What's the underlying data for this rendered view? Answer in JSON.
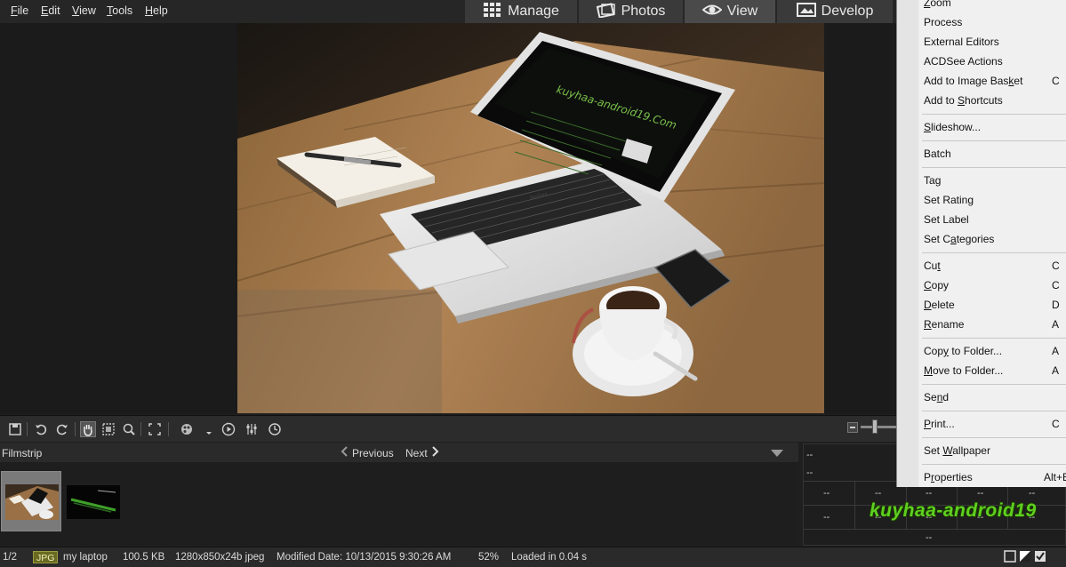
{
  "menubar": {
    "items": [
      "File",
      "Edit",
      "View",
      "Tools",
      "Help"
    ],
    "underline_letters": [
      "F",
      "E",
      "V",
      "T",
      "H"
    ]
  },
  "modes": [
    {
      "label": "Manage",
      "icon": "grid-icon"
    },
    {
      "label": "Photos",
      "icon": "photos-icon"
    },
    {
      "label": "View",
      "icon": "eye-icon",
      "active": true
    },
    {
      "label": "Develop",
      "icon": "develop-icon"
    }
  ],
  "photo": {
    "screen_brand": "kuyhaa-android19.Com",
    "keyboard_brand": "kuyhaa"
  },
  "toolbar": {
    "icons": [
      "save-icon",
      "rotate-left-icon",
      "rotate-right-icon",
      "hand-tool-icon",
      "select-tool-icon",
      "zoom-tool-icon",
      "fit-screen-icon",
      "color-wheel-icon",
      "dropdown-caret-icon",
      "play-slideshow-icon",
      "adjust-sliders-icon",
      "history-icon"
    ],
    "active_icon": "hand-tool-icon"
  },
  "filmstrip": {
    "title": "Filmstrip",
    "previous_label": "Previous",
    "next_label": "Next"
  },
  "info_panel": {
    "row1": "--",
    "row2": "--",
    "grid_values": [
      "--",
      "--",
      "--",
      "--",
      "--",
      "--",
      "--",
      "--",
      "--",
      "--",
      "--"
    ]
  },
  "statusbar": {
    "position": "1/2",
    "format_badge": "JPG",
    "filename": "my laptop",
    "filesize": "100.5 KB",
    "dimensions": "1280x850x24b jpeg",
    "modified": "Modified Date: 10/13/2015 9:30:26 AM",
    "zoom": "52%",
    "loaded": "Loaded in 0.04 s"
  },
  "context_menu": {
    "items": [
      {
        "label": "Zoom",
        "ul": "Z",
        "shortcut": ""
      },
      {
        "label": "Process",
        "ul": "",
        "shortcut": ""
      },
      {
        "label": "External Editors",
        "ul": "",
        "shortcut": ""
      },
      {
        "label": "ACDSee Actions",
        "ul": "",
        "shortcut": ""
      },
      {
        "label": "Add to Image Basket",
        "ul": "k",
        "shortcut": "C"
      },
      {
        "label": "Add to Shortcuts",
        "ul": "S",
        "shortcut": ""
      },
      {
        "label": "Slideshow...",
        "ul": "S",
        "shortcut": ""
      },
      {
        "label": "Batch",
        "ul": "",
        "shortcut": ""
      },
      {
        "label": "Tag",
        "ul": "g",
        "shortcut": ""
      },
      {
        "label": "Set Rating",
        "ul": "",
        "shortcut": ""
      },
      {
        "label": "Set Label",
        "ul": "",
        "shortcut": ""
      },
      {
        "label": "Set Categories",
        "ul": "a",
        "shortcut": ""
      },
      {
        "label": "Cut",
        "ul": "t",
        "shortcut": "C"
      },
      {
        "label": "Copy",
        "ul": "C",
        "shortcut": "C"
      },
      {
        "label": "Delete",
        "ul": "D",
        "shortcut": "D"
      },
      {
        "label": "Rename",
        "ul": "R",
        "shortcut": "A"
      },
      {
        "label": "Copy to Folder...",
        "ul": "y",
        "shortcut": "A"
      },
      {
        "label": "Move to Folder...",
        "ul": "M",
        "shortcut": "A"
      },
      {
        "label": "Send",
        "ul": "n",
        "shortcut": ""
      },
      {
        "label": "Print...",
        "ul": "P",
        "shortcut": "C"
      },
      {
        "label": "Set Wallpaper",
        "ul": "W",
        "shortcut": ""
      },
      {
        "label": "Properties",
        "ul": "r",
        "shortcut": "Alt+E"
      }
    ]
  },
  "watermark": "kuyhaa-android19",
  "colors": {
    "app_bg": "#1f1f1f",
    "menu_bg": "#f0f0f0",
    "watermark": "#5fd020",
    "mode_active": "#4a4a4a"
  }
}
